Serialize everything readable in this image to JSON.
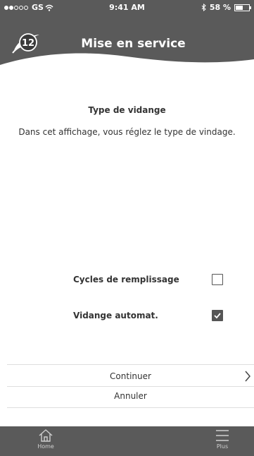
{
  "status_bar": {
    "carrier": "GS",
    "time": "9:41 AM",
    "battery": "58 %",
    "battery_level": 0.58
  },
  "header": {
    "step_number": "12",
    "title": "Mise en service"
  },
  "content": {
    "section_title": "Type de vidange",
    "description": "Dans cet affichage, vous réglez le type de vindage."
  },
  "options": [
    {
      "label": "Cycles de remplissage",
      "checked": false
    },
    {
      "label": "Vidange automat.",
      "checked": true
    }
  ],
  "actions": {
    "continue_label": "Continuer",
    "cancel_label": "Annuler"
  },
  "tabbar": {
    "home_label": "Home",
    "more_label": "Plus"
  },
  "colors": {
    "header_bg": "#5a5a5a",
    "tabbar_bg": "#5a5a5a",
    "text": "#333333",
    "checkbox": "#555555"
  },
  "icons": [
    "wifi-icon",
    "bluetooth-icon",
    "battery-icon",
    "logo-badge-icon",
    "chevron-right-icon",
    "home-icon",
    "menu-icon",
    "check-icon"
  ]
}
